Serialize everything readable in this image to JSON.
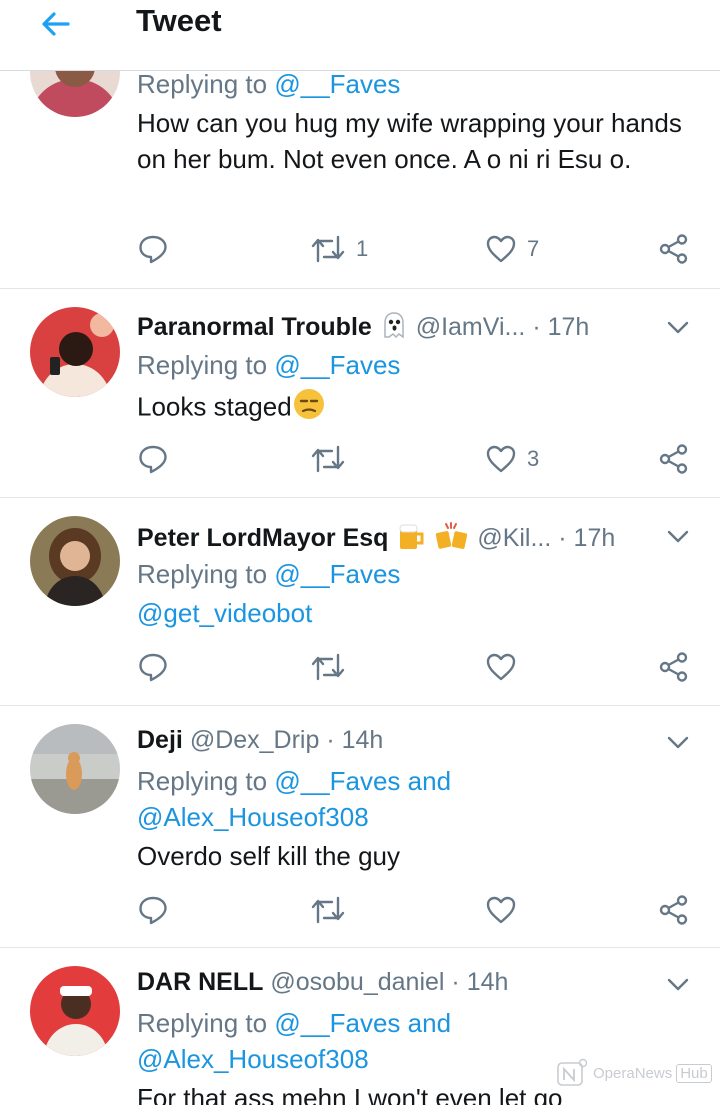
{
  "header": {
    "title": "Tweet"
  },
  "tweets": [
    {
      "name": "",
      "handle": "",
      "time": "",
      "replying_label": "Replying to",
      "replying_to": "@__Faves",
      "text": "How can you hug my wife wrapping your hands on her bum. Not even once. A o ni ri Esu o.",
      "retweets": "1",
      "likes": "7"
    },
    {
      "name": "Paranormal Trouble",
      "handle": "@IamVi...",
      "time": "17h",
      "replying_label": "Replying to",
      "replying_to": "@__Faves",
      "text": "Looks staged",
      "retweets": "",
      "likes": "3"
    },
    {
      "name": "Peter LordMayor Esq",
      "handle": "@Kil...",
      "time": "17h",
      "replying_label": "Replying to",
      "replying_to": "@__Faves",
      "text": "@get_videobot",
      "retweets": "",
      "likes": ""
    },
    {
      "name": "Deji",
      "handle": "@Dex_Drip",
      "time": "14h",
      "replying_label": "Replying to",
      "replying_to": "@__Faves and",
      "replying_to_2": "@Alex_Houseof308",
      "text": "Overdo self kill the guy",
      "retweets": "",
      "likes": ""
    },
    {
      "name": "DAR NELL",
      "handle": "@osobu_daniel",
      "time": "14h",
      "replying_label": "Replying to",
      "replying_to": "@__Faves and",
      "replying_to_2": "@Alex_Houseof308",
      "text": "For that ass mehn I won't even let go"
    }
  ],
  "separator": "·",
  "watermark": {
    "text": "OperaNews",
    "box": "Hub"
  },
  "colors": {
    "link": "#1b95e0",
    "muted": "#657786",
    "text": "#14171a",
    "divider": "#e1e8ed"
  }
}
